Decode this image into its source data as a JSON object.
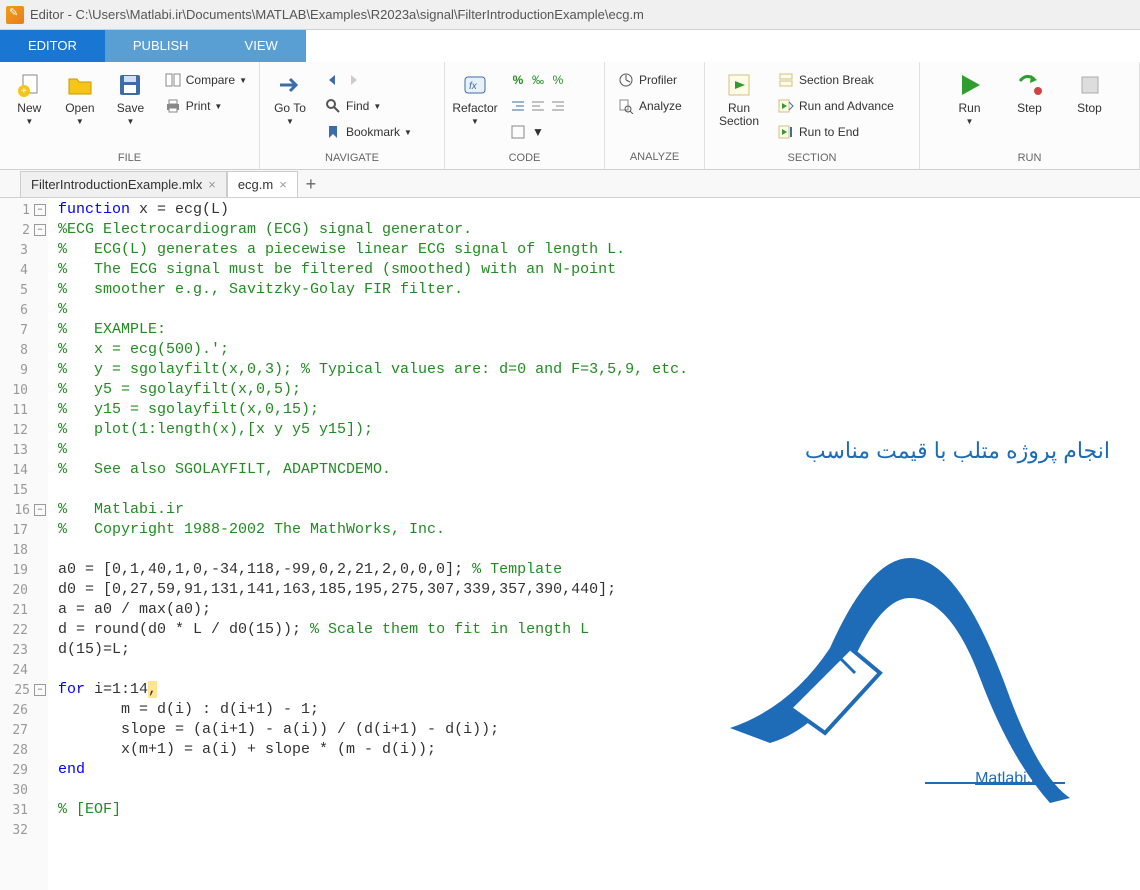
{
  "window": {
    "title": "Editor - C:\\Users\\Matlabi.ir\\Documents\\MATLAB\\Examples\\R2023a\\signal\\FilterIntroductionExample\\ecg.m"
  },
  "ribbon": {
    "tabs": [
      "EDITOR",
      "PUBLISH",
      "VIEW"
    ],
    "active_tab": 0,
    "groups": {
      "file": {
        "label": "FILE",
        "new": "New",
        "open": "Open",
        "save": "Save",
        "compare": "Compare",
        "print": "Print"
      },
      "navigate": {
        "label": "NAVIGATE",
        "goto": "Go To",
        "find": "Find",
        "bookmark": "Bookmark"
      },
      "code": {
        "label": "CODE",
        "refactor": "Refactor"
      },
      "analyze": {
        "label": "ANALYZE",
        "profiler": "Profiler",
        "analyze": "Analyze"
      },
      "section": {
        "label": "SECTION",
        "run_section": "Run\nSection",
        "section_break": "Section Break",
        "run_advance": "Run and Advance",
        "run_to_end": "Run to End"
      },
      "run": {
        "label": "RUN",
        "run": "Run",
        "step": "Step",
        "stop": "Stop"
      }
    }
  },
  "file_tabs": {
    "tabs": [
      {
        "name": "FilterIntroductionExample.mlx",
        "active": false
      },
      {
        "name": "ecg.m",
        "active": true
      }
    ]
  },
  "code": {
    "lines": [
      {
        "n": 1,
        "fold": "-",
        "tokens": [
          {
            "t": "function",
            "c": "kw"
          },
          {
            "t": " x = ecg(L)"
          }
        ]
      },
      {
        "n": 2,
        "fold": "-",
        "tokens": [
          {
            "t": "%ECG Electrocardiogram (ECG) signal generator.",
            "c": "com"
          }
        ]
      },
      {
        "n": 3,
        "tokens": [
          {
            "t": "%   ECG(L) generates a piecewise linear ECG signal of length L.",
            "c": "com"
          }
        ]
      },
      {
        "n": 4,
        "tokens": [
          {
            "t": "%   The ECG signal must be filtered (smoothed) with an N-point",
            "c": "com"
          }
        ]
      },
      {
        "n": 5,
        "tokens": [
          {
            "t": "%   smoother e.g., Savitzky-Golay FIR filter.",
            "c": "com"
          }
        ]
      },
      {
        "n": 6,
        "tokens": [
          {
            "t": "%",
            "c": "com"
          }
        ]
      },
      {
        "n": 7,
        "tokens": [
          {
            "t": "%   EXAMPLE:",
            "c": "com"
          }
        ]
      },
      {
        "n": 8,
        "tokens": [
          {
            "t": "%   x = ecg(500).';",
            "c": "com"
          }
        ]
      },
      {
        "n": 9,
        "tokens": [
          {
            "t": "%   y = sgolayfilt(x,0,3); % Typical values are: d=0 and F=3,5,9, etc.",
            "c": "com"
          }
        ]
      },
      {
        "n": 10,
        "tokens": [
          {
            "t": "%   y5 = sgolayfilt(x,0,5);",
            "c": "com"
          }
        ]
      },
      {
        "n": 11,
        "tokens": [
          {
            "t": "%   y15 = sgolayfilt(x,0,15);",
            "c": "com"
          }
        ]
      },
      {
        "n": 12,
        "tokens": [
          {
            "t": "%   plot(1:length(x),[x y y5 y15]);",
            "c": "com"
          }
        ]
      },
      {
        "n": 13,
        "tokens": [
          {
            "t": "%",
            "c": "com"
          }
        ]
      },
      {
        "n": 14,
        "tokens": [
          {
            "t": "%   See also SGOLAYFILT, ADAPTNCDEMO.",
            "c": "com"
          }
        ]
      },
      {
        "n": 15,
        "tokens": [
          {
            "t": ""
          }
        ]
      },
      {
        "n": 16,
        "fold": "-",
        "tokens": [
          {
            "t": "%   Matlabi.ir",
            "c": "com"
          }
        ]
      },
      {
        "n": 17,
        "tokens": [
          {
            "t": "%   Copyright 1988-2002 The MathWorks, Inc.",
            "c": "com"
          }
        ]
      },
      {
        "n": 18,
        "tokens": [
          {
            "t": ""
          }
        ]
      },
      {
        "n": 19,
        "tokens": [
          {
            "t": "a0 = [0,1,40,1,0,-34,118,-99,0,2,21,2,0,0,0]; "
          },
          {
            "t": "% Template",
            "c": "com"
          }
        ]
      },
      {
        "n": 20,
        "tokens": [
          {
            "t": "d0 = [0,27,59,91,131,141,163,185,195,275,307,339,357,390,440];"
          }
        ]
      },
      {
        "n": 21,
        "tokens": [
          {
            "t": "a = a0 / max(a0);"
          }
        ]
      },
      {
        "n": 22,
        "tokens": [
          {
            "t": "d = round(d0 * L / d0(15)); "
          },
          {
            "t": "% Scale them to fit in length L",
            "c": "com"
          }
        ]
      },
      {
        "n": 23,
        "tokens": [
          {
            "t": "d(15)=L;"
          }
        ]
      },
      {
        "n": 24,
        "tokens": [
          {
            "t": ""
          }
        ]
      },
      {
        "n": 25,
        "fold": "-",
        "tokens": [
          {
            "t": "for",
            "c": "kw"
          },
          {
            "t": " i=1:14"
          },
          {
            "t": ",",
            "c": "hl"
          }
        ]
      },
      {
        "n": 26,
        "tokens": [
          {
            "t": "       m = d(i) : d(i+1) - 1;"
          }
        ]
      },
      {
        "n": 27,
        "tokens": [
          {
            "t": "       slope = (a(i+1) - a(i)) / (d(i+1) - d(i));"
          }
        ]
      },
      {
        "n": 28,
        "tokens": [
          {
            "t": "       x(m+1) = a(i) + slope * (m - d(i));"
          }
        ]
      },
      {
        "n": 29,
        "tokens": [
          {
            "t": "end",
            "c": "kw"
          }
        ]
      },
      {
        "n": 30,
        "tokens": [
          {
            "t": ""
          }
        ]
      },
      {
        "n": 31,
        "tokens": [
          {
            "t": "% [EOF]",
            "c": "com"
          }
        ]
      },
      {
        "n": 32,
        "tokens": [
          {
            "t": ""
          }
        ]
      }
    ]
  },
  "overlay": {
    "caption": "انجام پروژه متلب با قیمت مناسب",
    "brand": "Matlabi.ir"
  }
}
